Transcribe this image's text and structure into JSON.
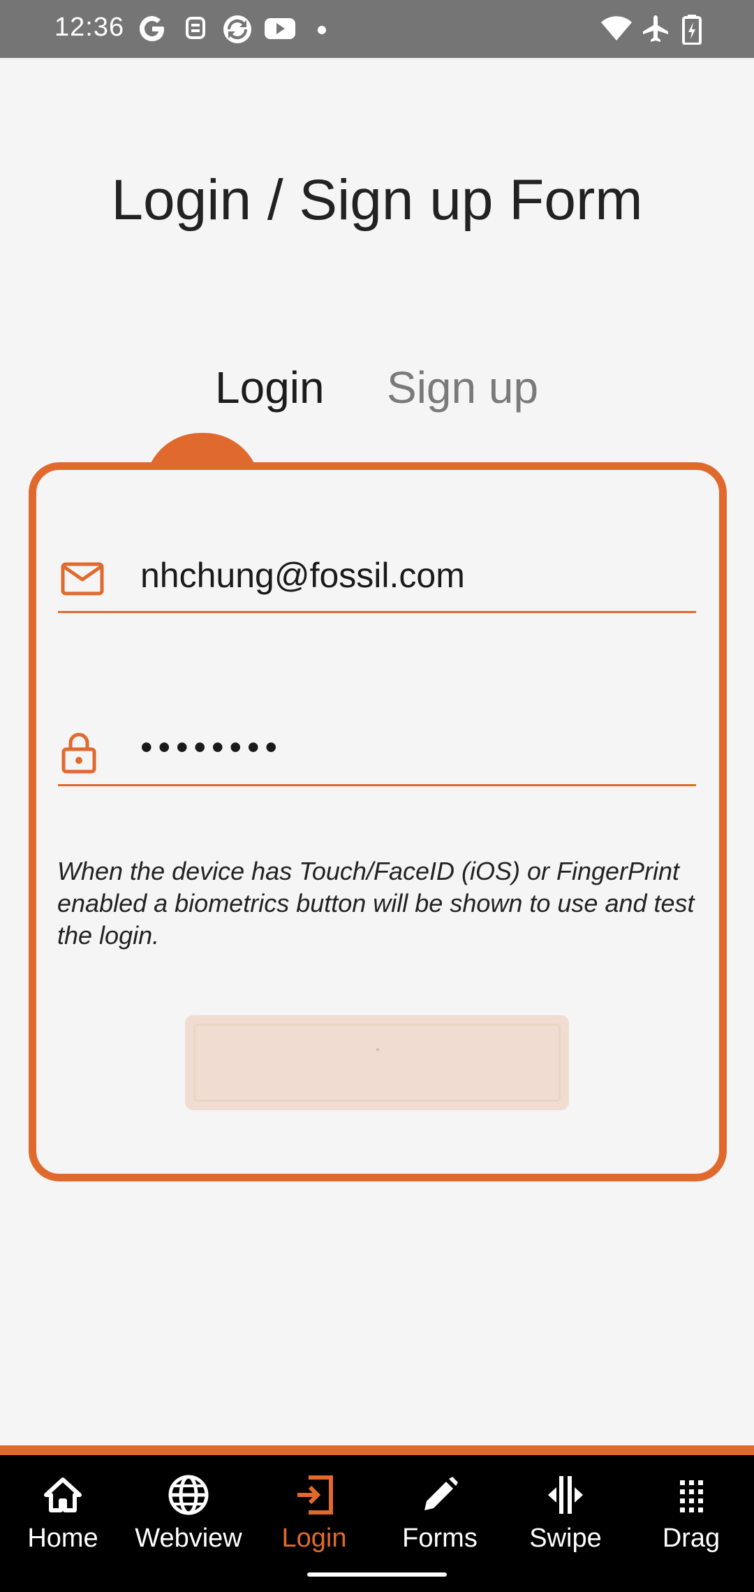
{
  "status_bar": {
    "time": "12:36",
    "icons": [
      "google-icon",
      "assistant-icon",
      "sync-icon",
      "youtube-icon",
      "dot-icon",
      "wifi-icon",
      "airplane-icon",
      "battery-icon"
    ]
  },
  "page": {
    "title": "Login / Sign up Form"
  },
  "tabs": [
    {
      "label": "Login",
      "active": true
    },
    {
      "label": "Sign up",
      "active": false
    }
  ],
  "form": {
    "email": {
      "icon": "mail-icon",
      "value": "nhchung@fossil.com"
    },
    "password": {
      "icon": "lock-icon",
      "value": "••••••••"
    },
    "note": "When the device has Touch/FaceID (iOS) or FingerPrint enabled a biometrics button will be shown to use and test the login.",
    "login_button_label": ""
  },
  "bottom_nav": {
    "items": [
      {
        "label": "Home",
        "icon": "home-icon",
        "active": false
      },
      {
        "label": "Webview",
        "icon": "globe-icon",
        "active": false
      },
      {
        "label": "Login",
        "icon": "login-icon",
        "active": true
      },
      {
        "label": "Forms",
        "icon": "pencil-icon",
        "active": false
      },
      {
        "label": "Swipe",
        "icon": "swipe-icon",
        "active": false
      },
      {
        "label": "Drag",
        "icon": "grid-icon",
        "active": false
      }
    ]
  },
  "colors": {
    "accent": "#e06a2d",
    "background": "#f5f5f5",
    "status_bar": "#757575",
    "nav_background": "#000000"
  }
}
